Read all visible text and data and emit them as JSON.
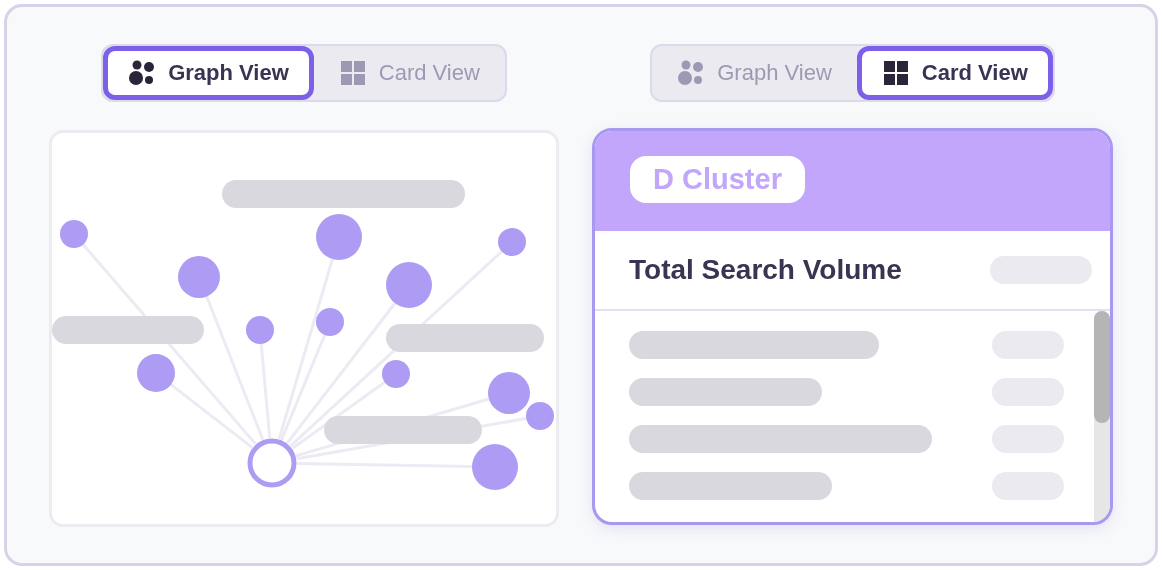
{
  "left_toggle": {
    "options": [
      {
        "label": "Graph View",
        "kind": "graph",
        "selected": true
      },
      {
        "label": "Card View",
        "kind": "card",
        "selected": false
      }
    ]
  },
  "right_toggle": {
    "options": [
      {
        "label": "Graph View",
        "kind": "graph",
        "selected": false
      },
      {
        "label": "Card View",
        "kind": "card",
        "selected": true
      }
    ]
  },
  "card": {
    "title": "D Cluster",
    "header_label": "Total Search Volume"
  }
}
